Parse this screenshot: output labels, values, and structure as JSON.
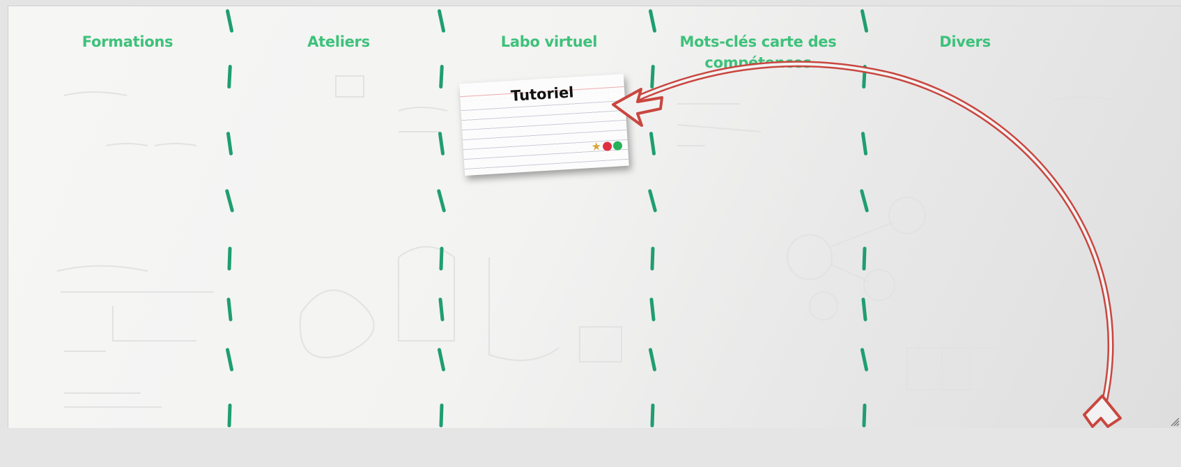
{
  "columns": [
    {
      "title": "Formations"
    },
    {
      "title": "Ateliers"
    },
    {
      "title": "Labo virtuel"
    },
    {
      "title": "Mots-clés carte des compétences"
    },
    {
      "title": "Divers"
    }
  ],
  "card": {
    "title": "Tutoriel",
    "icons": [
      "star-icon",
      "red-dot-icon",
      "green-dot-icon"
    ]
  },
  "colors": {
    "title": "#3ec17a",
    "divider": "#1f9e70",
    "arrow": "#c9463f"
  }
}
